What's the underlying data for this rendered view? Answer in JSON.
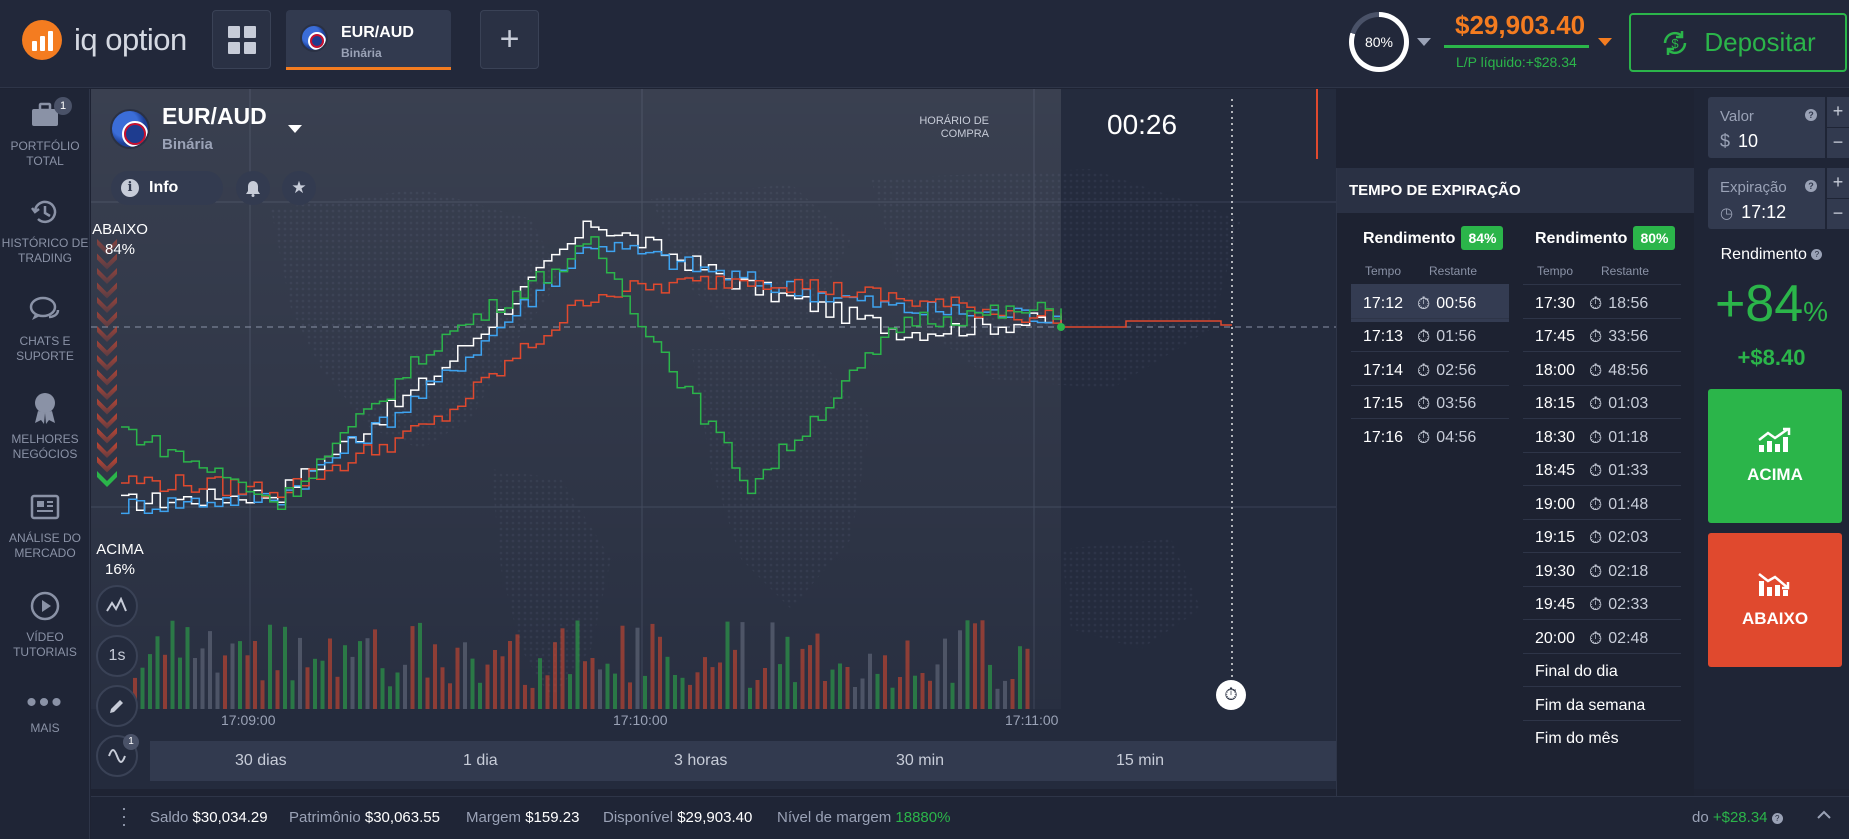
{
  "colors": {
    "accent": "#f47c20",
    "green": "#2bb54a",
    "red": "#e0492e",
    "background": "#1e2333"
  },
  "header": {
    "logo_text": "iq option",
    "asset_tab": {
      "name": "EUR/AUD",
      "type": "Binária"
    },
    "add_tab_icon": "plus-icon",
    "gauge_value": "80%",
    "balance": "$29,903.40",
    "pl_text": "L/P líquido:+$28.34",
    "deposit_label": "Depositar"
  },
  "sidebar": {
    "items": [
      {
        "label": "PORTFÓLIO TOTAL",
        "icon": "briefcase-icon",
        "badge": "1"
      },
      {
        "label": "HISTÓRICO DE TRADING",
        "icon": "history-icon"
      },
      {
        "label": "CHATS E SUPORTE",
        "icon": "chat-icon"
      },
      {
        "label": "MELHORES NEGÓCIOS",
        "icon": "award-icon"
      },
      {
        "label": "ANÁLISE DO MERCADO",
        "icon": "news-icon"
      },
      {
        "label": "VÍDEO TUTORIAIS",
        "icon": "play-icon"
      },
      {
        "label": "MAIS",
        "icon": "more-icon"
      }
    ]
  },
  "chart": {
    "asset_name": "EUR/AUD",
    "asset_type": "Binária",
    "info_label": "Info",
    "buy_time_label": "HORÁRIO DE\nCOMPRA",
    "buy_time_value": "00:26",
    "down_label": "ABAIXO",
    "down_pct": "84%",
    "up_label": "ACIMA",
    "up_pct": "16%",
    "interval_label": "1s",
    "indicator_badge": "1",
    "time_labels": [
      "17:09:00",
      "17:10:00",
      "17:11:00"
    ],
    "periods": [
      "30 dias",
      "1 dia",
      "3 horas",
      "30 min",
      "15 min"
    ]
  },
  "chart_data": {
    "type": "line",
    "x": [
      "17:08:42",
      "17:09:00",
      "17:09:30",
      "17:10:00",
      "17:10:30",
      "17:11:00",
      "17:11:30"
    ],
    "series": [
      {
        "color": "#ffffff",
        "values": [
          0.05,
          0.08,
          0.45,
          0.92,
          0.72,
          0.58,
          0.62
        ]
      },
      {
        "color": "#3ea3f0",
        "values": [
          0.04,
          0.07,
          0.42,
          0.86,
          0.74,
          0.65,
          0.63
        ]
      },
      {
        "color": "#e0492e",
        "values": [
          0.12,
          0.09,
          0.3,
          0.7,
          0.75,
          0.68,
          0.62
        ]
      },
      {
        "color": "#2bb54a",
        "values": [
          0.28,
          0.05,
          0.55,
          0.85,
          0.1,
          0.62,
          0.65
        ]
      }
    ],
    "volume": true,
    "grid": true
  },
  "expiration": {
    "title": "TEMPO DE EXPIRAÇÃO",
    "col1": {
      "yield_label": "Rendimento",
      "yield": "84%",
      "h_time": "Tempo",
      "h_rem": "Restante",
      "rows": [
        {
          "time": "17:12",
          "rem": "00:56"
        },
        {
          "time": "17:13",
          "rem": "01:56"
        },
        {
          "time": "17:14",
          "rem": "02:56"
        },
        {
          "time": "17:15",
          "rem": "03:56"
        },
        {
          "time": "17:16",
          "rem": "04:56"
        }
      ]
    },
    "col2": {
      "yield_label": "Rendimento",
      "yield": "80%",
      "h_time": "Tempo",
      "h_rem": "Restante",
      "rows": [
        {
          "time": "17:30",
          "rem": "18:56"
        },
        {
          "time": "17:45",
          "rem": "33:56"
        },
        {
          "time": "18:00",
          "rem": "48:56"
        },
        {
          "time": "18:15",
          "rem": "01:03"
        },
        {
          "time": "18:30",
          "rem": "01:18"
        },
        {
          "time": "18:45",
          "rem": "01:33"
        },
        {
          "time": "19:00",
          "rem": "01:48"
        },
        {
          "time": "19:15",
          "rem": "02:03"
        },
        {
          "time": "19:30",
          "rem": "02:18"
        },
        {
          "time": "19:45",
          "rem": "02:33"
        },
        {
          "time": "20:00",
          "rem": "02:48"
        }
      ],
      "extra": [
        "Final do dia",
        "Fim da semana",
        "Fim do mês"
      ]
    }
  },
  "trade": {
    "amount_label": "Valor",
    "currency": "$",
    "amount": "10",
    "expiry_label": "Expiração",
    "expiry": "17:12",
    "yield_label": "Rendimento",
    "yield_value": "+84",
    "yield_pct": "%",
    "profit": "+$8.40",
    "up_label": "ACIMA",
    "down_label": "ABAIXO"
  },
  "footer": {
    "saldo_label": "Saldo",
    "saldo": "$30,034.29",
    "patrimonio_label": "Patrimônio",
    "patrimonio": "$30,063.55",
    "margem_label": "Margem",
    "margem": "$159.23",
    "disponivel_label": "Disponível",
    "disponivel": "$29,903.40",
    "nivel_label": "Nível de margem",
    "nivel": "18880%",
    "pl_tail_label": "do",
    "pl_tail": "+$28.34"
  }
}
